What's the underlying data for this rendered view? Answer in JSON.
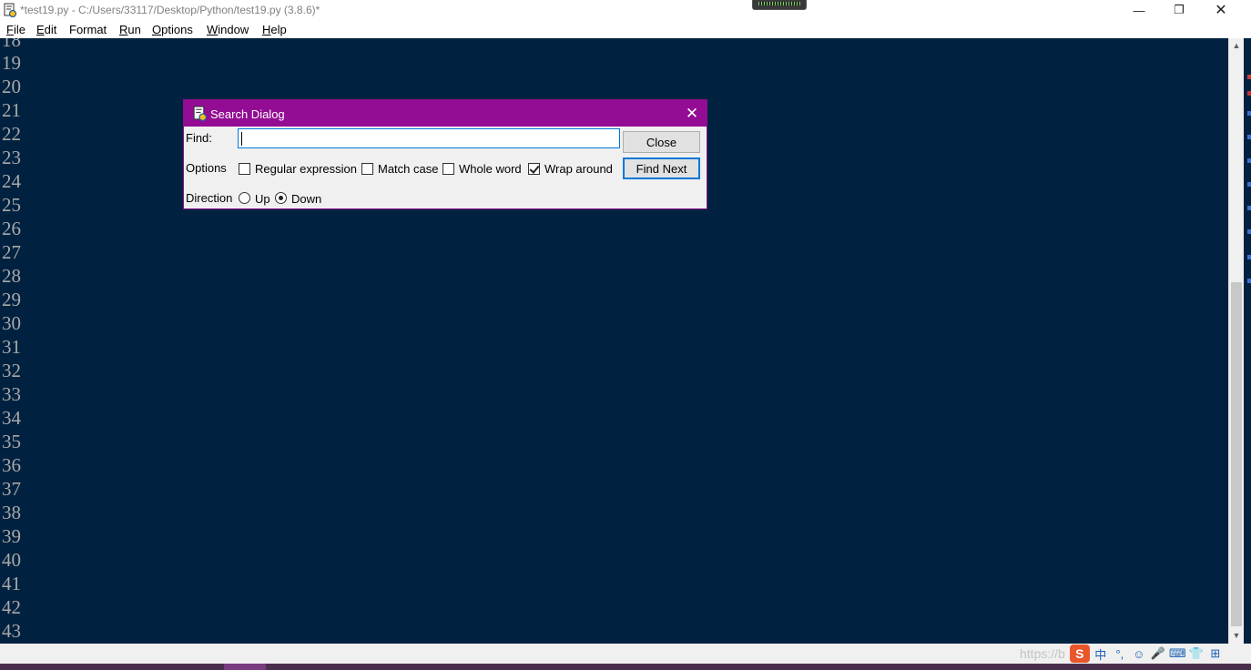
{
  "window": {
    "title": "*test19.py - C:/Users/33117/Desktop/Python/test19.py (3.8.6)*",
    "controls": {
      "minimize": "—",
      "maximize": "❐",
      "close": "✕"
    }
  },
  "menu": [
    {
      "label": "File",
      "ul": "F",
      "rest": "ile"
    },
    {
      "label": "Edit",
      "ul": "E",
      "rest": "dit"
    },
    {
      "label": "Format",
      "ul": "",
      "rest": "Format"
    },
    {
      "label": "Run",
      "ul": "R",
      "rest": "un"
    },
    {
      "label": "Options",
      "ul": "O",
      "rest": "ptions"
    },
    {
      "label": "Window",
      "ul": "W",
      "rest": "indow"
    },
    {
      "label": "Help",
      "ul": "H",
      "rest": "elp"
    }
  ],
  "editor": {
    "background": "#002240",
    "line_numbers": [
      "18",
      "19",
      "20",
      "21",
      "22",
      "23",
      "24",
      "25",
      "26",
      "27",
      "28",
      "29",
      "30",
      "31",
      "32",
      "33",
      "34",
      "35",
      "36",
      "37",
      "38",
      "39",
      "40",
      "41",
      "42",
      "43"
    ]
  },
  "dialog": {
    "title": "Search Dialog",
    "close_glyph": "✕",
    "find_label": "Find:",
    "find_value": "",
    "options_label": "Options",
    "options": [
      {
        "label": "Regular expression",
        "checked": false
      },
      {
        "label": "Match case",
        "checked": false
      },
      {
        "label": "Whole word",
        "checked": false
      },
      {
        "label": "Wrap around",
        "checked": true
      }
    ],
    "direction_label": "Direction",
    "directions": [
      {
        "label": "Up",
        "checked": false
      },
      {
        "label": "Down",
        "checked": true
      }
    ],
    "close_button": "Close",
    "find_next_button": "Find Next",
    "title_color": "#930c93"
  },
  "taskbar": {
    "watermark": "https://b",
    "sogou": "S",
    "tray_icons": [
      "中",
      "°,",
      "☺",
      "🎤",
      "⌨",
      "👕",
      "⊞"
    ]
  }
}
